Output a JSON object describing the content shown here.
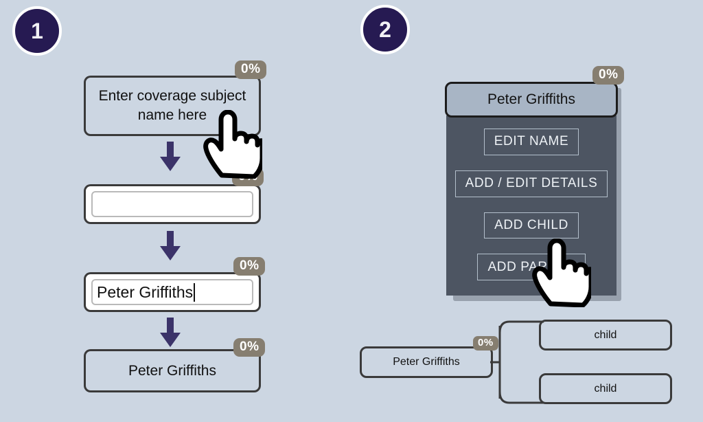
{
  "theme": {
    "background": "#ccd6e2",
    "step_circle_fill": "#261a52",
    "step_circle_ring": "#ffffff",
    "badge_fill": "#867e70",
    "badge_text": "#ffffff",
    "box_border": "#3a3a3a",
    "arrow_color": "#3b3369",
    "menu_header_fill": "#a8b5c5",
    "menu_body_fill": "#4d5562",
    "menu_btn_border": "#b4c0cc",
    "input_field_border": "#b9b9b9"
  },
  "steps": [
    {
      "number": "1"
    },
    {
      "number": "2"
    }
  ],
  "step1": {
    "prompt_box": {
      "text": "Enter coverage subject name here",
      "badge": "0%"
    },
    "empty_input": {
      "value": "",
      "placeholder": "",
      "badge": "0%"
    },
    "typed_input": {
      "value": "Peter Griffiths",
      "badge": "0%"
    },
    "result_box": {
      "text": "Peter Griffiths",
      "badge": "0%"
    },
    "arrows": [
      {
        "name": "arrow-prompt-to-empty"
      },
      {
        "name": "arrow-empty-to-typed"
      },
      {
        "name": "arrow-typed-to-result"
      }
    ],
    "cursor": {
      "name": "hand-pointer-cursor"
    }
  },
  "step2": {
    "menu": {
      "header_title": "Peter Griffiths",
      "badge": "0%",
      "buttons": [
        {
          "label": "EDIT NAME"
        },
        {
          "label": "ADD / EDIT DETAILS"
        },
        {
          "label": "ADD CHILD"
        },
        {
          "label": "ADD PARENT"
        }
      ]
    },
    "cursor": {
      "name": "hand-pointer-cursor"
    },
    "tree": {
      "root": {
        "label": "Peter Griffiths",
        "badge": "0%"
      },
      "children": [
        {
          "label": "child"
        },
        {
          "label": "child"
        }
      ]
    }
  }
}
